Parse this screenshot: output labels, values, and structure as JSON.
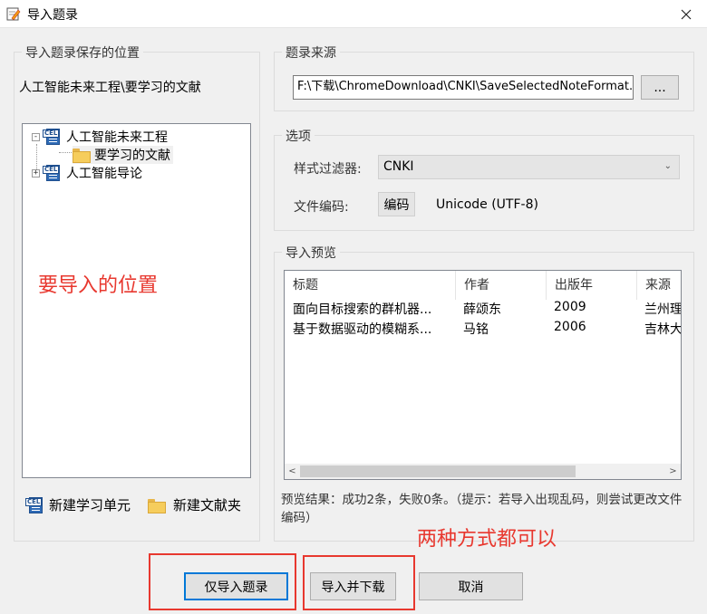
{
  "window": {
    "title": "导入题录",
    "close_glyph": "X"
  },
  "left_group": {
    "title": "导入题录保存的位置",
    "current_path": "人工智能未来工程\\要学习的文献",
    "tree": [
      {
        "label": "人工智能未来工程",
        "icon": "cel-project-icon",
        "expander": "-"
      },
      {
        "label": "要学习的文献",
        "icon": "folder-icon"
      },
      {
        "label": "人工智能导论",
        "icon": "cel-project-icon",
        "expander": "+"
      }
    ],
    "annotation": "要导入的位置",
    "new_unit_label": "新建学习单元",
    "new_folder_label": "新建文献夹",
    "cel_tag": "CEL"
  },
  "source_group": {
    "title": "题录来源",
    "file_path": "F:\\下载\\ChromeDownload\\CNKI\\SaveSelectedNoteFormat.eln",
    "browse_label": "..."
  },
  "options_group": {
    "title": "选项",
    "filter_label": "样式过滤器:",
    "filter_value": "CNKI",
    "encoding_label": "文件编码:",
    "encoding_button": "编码",
    "encoding_value": "Unicode (UTF-8)"
  },
  "preview_group": {
    "title": "导入预览",
    "columns": [
      "标题",
      "作者",
      "出版年",
      "来源"
    ],
    "rows": [
      [
        "面向目标搜索的群机器...",
        "薛颂东",
        "2009",
        "兰州理"
      ],
      [
        "基于数据驱动的模糊系...",
        "马铭",
        "2006",
        "吉林大"
      ]
    ],
    "result_text": "预览结果：成功2条，失败0条。（提示：若导入出现乱码，则尝试更改文件编码）",
    "annotation": "两种方式都可以"
  },
  "buttons": {
    "import_only": "仅导入题录",
    "import_download": "导入并下载",
    "cancel": "取消"
  },
  "colors": {
    "annotation_red": "#e8382f",
    "focus_blue": "#0078d7"
  }
}
